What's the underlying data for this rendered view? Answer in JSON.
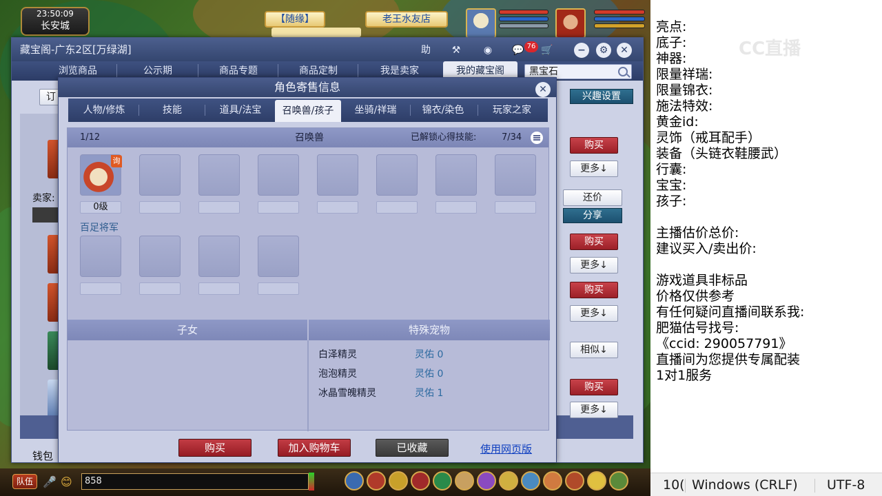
{
  "hud": {
    "time": "23:50:09",
    "city": "长安城",
    "banner_left": "【随缘】",
    "banner_right": "老王水友店"
  },
  "window": {
    "title": "藏宝阁-广东2区[万绿湖]",
    "help_label": "助",
    "message_count": "76",
    "nav_tabs": [
      {
        "label": "浏览商品"
      },
      {
        "label": "公示期"
      },
      {
        "label": "商品专题"
      },
      {
        "label": "商品定制"
      },
      {
        "label": "我是卖家"
      },
      {
        "label": "我的藏宝阁"
      }
    ],
    "search_value": "黑宝石",
    "order_label": "订",
    "interest_button": "兴趣设置",
    "seller_label": "卖家:",
    "wallet_label": "钱包",
    "item_buttons": {
      "buy": "购买",
      "more": "更多↓",
      "counter_offer": "还价",
      "share": "分享",
      "similar": "相似↓"
    }
  },
  "dialog": {
    "title": "角色寄售信息",
    "tabs": [
      {
        "label": "人物/修炼"
      },
      {
        "label": "技能"
      },
      {
        "label": "道具/法宝"
      },
      {
        "label": "召唤兽/孩子"
      },
      {
        "label": "坐骑/祥瑞"
      },
      {
        "label": "锦衣/染色"
      },
      {
        "label": "玩家之家"
      }
    ],
    "active_tab": 3,
    "pets": {
      "count": "1/12",
      "header": "召唤兽",
      "unlocked_skills_label": "已解锁心得技能:",
      "unlocked_skills_value": "7/34",
      "first_pet_level": "0级",
      "first_pet_tag": "询",
      "first_pet_name": "百足将军"
    },
    "children_header": "子女",
    "special_header": "特殊宠物",
    "special_pets": [
      {
        "name": "白泽精灵",
        "blessing": "灵佑 0"
      },
      {
        "name": "泡泡精灵",
        "blessing": "灵佑 0"
      },
      {
        "name": "冰晶雪魄精灵",
        "blessing": "灵佑 1"
      }
    ],
    "buttons": {
      "buy": "购买",
      "add_cart": "加入购物车",
      "collected": "已收藏",
      "web_link": "使用网页版"
    }
  },
  "chat": {
    "team_label": "队伍",
    "input_value": "858"
  },
  "notes": {
    "lines": [
      "亮点:",
      "底子:",
      "神器:",
      "限量祥瑞:",
      "限量锦衣:",
      "施法特效:",
      "黄金id:",
      "灵饰（戒耳配手）",
      "装备（头链衣鞋腰武）",
      "行囊:",
      "宝宝:",
      "孩子:",
      "",
      "主播估价总价:",
      "建议买入/卖出价:",
      "",
      "游戏道具非标品",
      "价格仅供参考",
      "有任何疑问直播间联系我:",
      "肥猫估号找号:",
      "《ccid: 290057791》",
      "直播间为您提供专属配装",
      "1对1服务"
    ],
    "watermark": "CC直播"
  },
  "statusbar": {
    "position": "10(",
    "line_ending": "Windows (CRLF)",
    "encoding": "UTF-8"
  },
  "colors": {
    "title_bar": "#34466f",
    "buy_red": "#9c2028",
    "link_blue": "#1040c0",
    "pet_name_blue": "#2f5d8f"
  }
}
